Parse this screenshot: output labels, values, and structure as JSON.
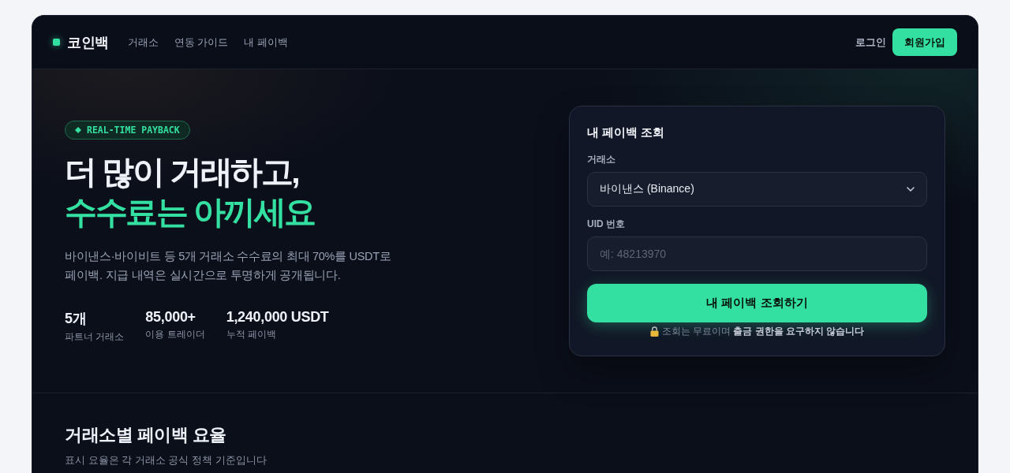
{
  "header": {
    "logo": "코인백",
    "nav": [
      {
        "label": "거래소"
      },
      {
        "label": "연동 가이드"
      },
      {
        "label": "내 페이백"
      }
    ],
    "login": "로그인",
    "signup": "회원가입"
  },
  "hero": {
    "badge": "REAL-TIME PAYBACK",
    "title_lines": [
      {
        "text": "더 많이 거래하고,",
        "highlight": false
      },
      {
        "text": "수수료는 아끼세요",
        "highlight": true
      }
    ],
    "description": "바이낸스·바이비트 등 5개 거래소 수수료의 최대 70%를 USDT로 페이백. 지급 내역은 실시간으로 투명하게 공개됩니다.",
    "stats": [
      {
        "value": "5개",
        "label": "파트너 거래소"
      },
      {
        "value": "85,000+",
        "label": "이용 트레이더"
      },
      {
        "value": "1,240,000 USDT",
        "label": "누적 페이백"
      }
    ]
  },
  "lookup_form": {
    "title": "내 페이백 조회",
    "fields": [
      {
        "kind": "select",
        "label": "거래소",
        "value": "바이낸스 (Binance)"
      },
      {
        "kind": "input",
        "label": "UID 번호",
        "placeholder": "예: 48213970"
      }
    ],
    "submit": "내 페이백 조회하기",
    "note": "조회는 무료이며 **출금 권한을 요구하지 않습니다**"
  },
  "rates_section": {
    "title": "거래소별 페이백 요율",
    "subtitle": "표시 요율은 각 거래소 공식 정책 기준입니다"
  }
}
